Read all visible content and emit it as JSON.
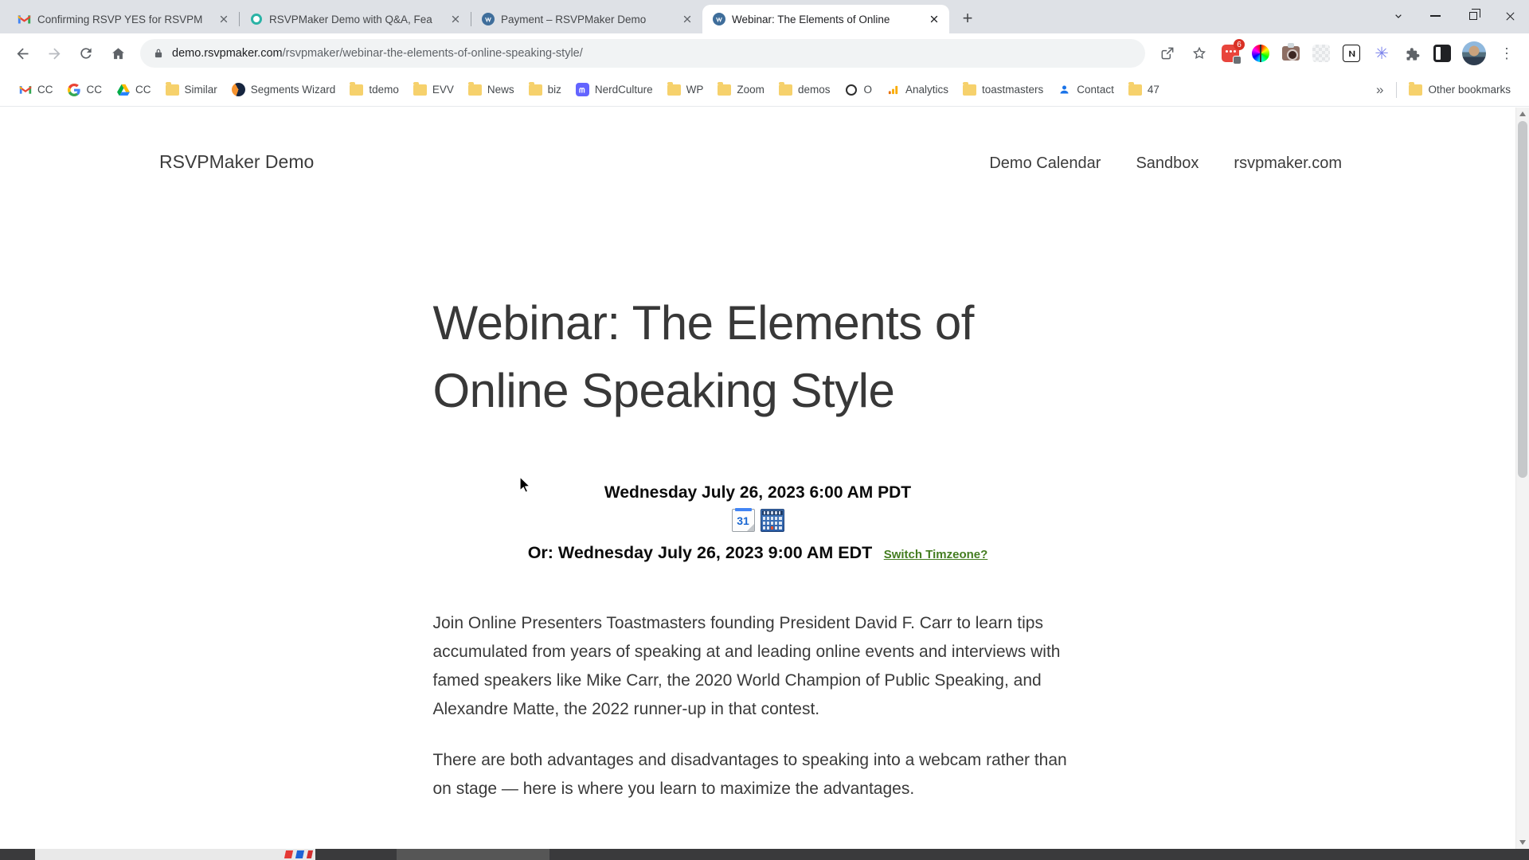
{
  "browser": {
    "tabs": [
      {
        "title": "Confirming RSVP YES for RSVPM",
        "icon": "gmail-icon"
      },
      {
        "title": "RSVPMaker Demo with Q&A, Fea",
        "icon": "clock-icon"
      },
      {
        "title": "Payment – RSVPMaker Demo",
        "icon": "wordpress-icon"
      },
      {
        "title": "Webinar: The Elements of Online",
        "icon": "wordpress-icon"
      }
    ],
    "new_tab_glyph": "+",
    "address": {
      "domain": "demo.rsvpmaker.com",
      "path": "/rsvpmaker/webinar-the-elements-of-online-speaking-style/"
    },
    "extension_badge": "6",
    "menu_glyph": "⋮",
    "snowflake_glyph": "✳",
    "bookmarks": [
      {
        "label": "CC",
        "icon": "gmail-icon"
      },
      {
        "label": "CC",
        "icon": "google-icon"
      },
      {
        "label": "CC",
        "icon": "drive-icon"
      },
      {
        "label": "Similar",
        "icon": "folder-icon"
      },
      {
        "label": "Segments Wizard",
        "icon": "segments-wizard-icon"
      },
      {
        "label": "tdemo",
        "icon": "folder-icon"
      },
      {
        "label": "EVV",
        "icon": "folder-icon"
      },
      {
        "label": "News",
        "icon": "folder-icon"
      },
      {
        "label": "biz",
        "icon": "folder-icon"
      },
      {
        "label": "NerdCulture",
        "icon": "mastodon-icon"
      },
      {
        "label": "WP",
        "icon": "folder-icon"
      },
      {
        "label": "Zoom",
        "icon": "folder-icon"
      },
      {
        "label": "demos",
        "icon": "folder-icon"
      },
      {
        "label": "O",
        "icon": "ring-icon"
      },
      {
        "label": "Analytics",
        "icon": "analytics-icon"
      },
      {
        "label": "toastmasters",
        "icon": "folder-icon"
      },
      {
        "label": "Contact",
        "icon": "person-icon"
      },
      {
        "label": "47",
        "icon": "folder-icon"
      }
    ],
    "overflow_glyph": "»",
    "other_bookmarks": {
      "label": "Other bookmarks",
      "icon": "folder-icon"
    }
  },
  "page": {
    "site_title": "RSVPMaker Demo",
    "nav": [
      {
        "label": "Demo Calendar"
      },
      {
        "label": "Sandbox"
      },
      {
        "label": "rsvpmaker.com"
      }
    ],
    "article": {
      "title": "Webinar: The Elements of Online Speaking Style",
      "datetime_primary": "Wednesday July 26, 2023 6:00 AM PDT",
      "gcal_label": "31",
      "datetime_secondary": "Or: Wednesday July 26, 2023 9:00 AM EDT",
      "switch_timezone_label": "Switch Timzeone?",
      "paragraphs": [
        "Join Online Presenters Toastmasters founding President David F. Carr to learn tips accumulated from years of speaking at and leading online events and interviews with famed speakers like Mike Carr, the 2020 World Champion of Public Speaking, and Alexandre Matte, the 2022 runner-up in that contest.",
        "There are both advantages and disadvantages to speaking into a webcam rather than on stage — here is where you learn to maximize the advantages."
      ]
    }
  },
  "colors": {
    "link_green": "#447d20",
    "tabbar_bg": "#dee1e6",
    "omnibox_bg": "#f1f3f4",
    "badge_red": "#d93025"
  }
}
